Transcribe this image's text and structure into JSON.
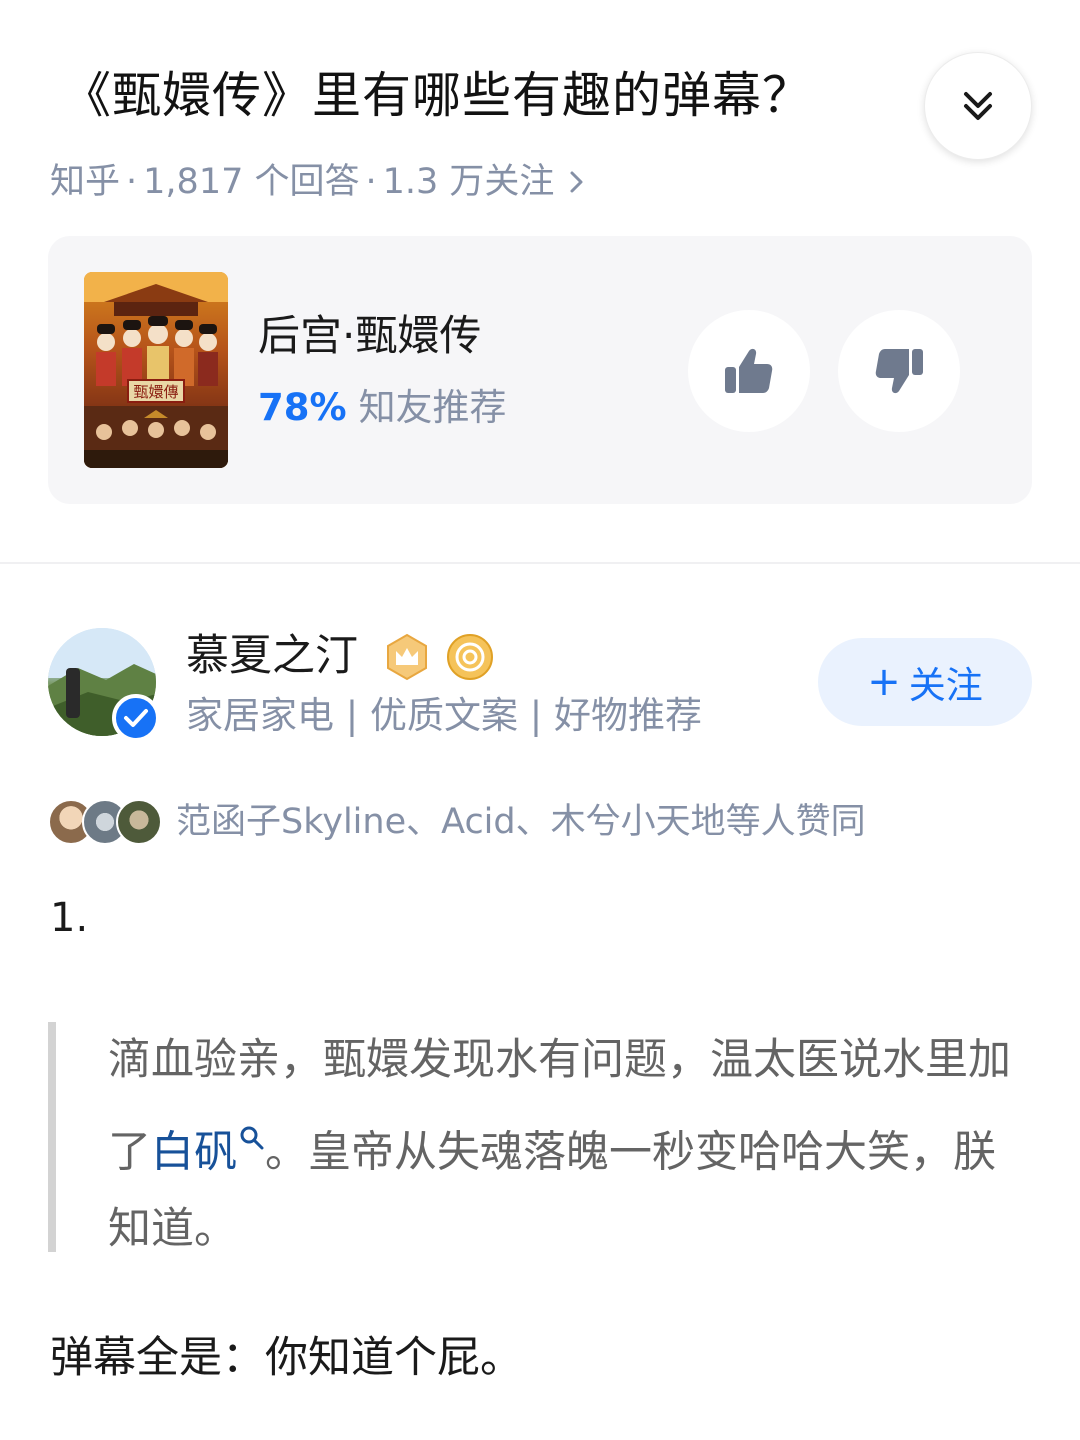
{
  "question": {
    "title": "《甄嬛传》里有哪些有趣的弹幕？",
    "source": "知乎",
    "answers": "1,817 个回答",
    "followers": "1.3 万关注"
  },
  "card": {
    "title": "后宫·甄嬛传",
    "rating_percent": "78%",
    "rating_label": "知友推荐",
    "poster_text": "甄嬛傳"
  },
  "author": {
    "name": "慕夏之汀",
    "bio": "家居家电 | 优质文案 | 好物推荐",
    "follow_label": "关注",
    "follow_plus": "+"
  },
  "voters": {
    "text": "范函子Skyline、Acid、木兮小天地等人赞同"
  },
  "content": {
    "para_number": "1.",
    "quote_part1": "滴血验亲，甄嬛发现水有问题，温太医说水里加了",
    "quote_link": "白矾",
    "quote_part2": "。皇帝从失魂落魄一秒变哈哈大笑，朕知道。",
    "final_line": "弹幕全是：你知道个屁。"
  },
  "colors": {
    "accent": "#1772f6",
    "meta": "#8590a6",
    "link": "#175199",
    "quote_bar": "#d3d3d3"
  },
  "icons": {
    "collapse": "double-chevron-down-icon",
    "meta_arrow": "chevron-right-icon",
    "upvote": "thumbs-up-icon",
    "downvote": "thumbs-down-icon",
    "verified": "verified-badge-icon",
    "crown": "crown-badge-icon",
    "coin": "coin-badge-icon",
    "search": "search-icon"
  }
}
